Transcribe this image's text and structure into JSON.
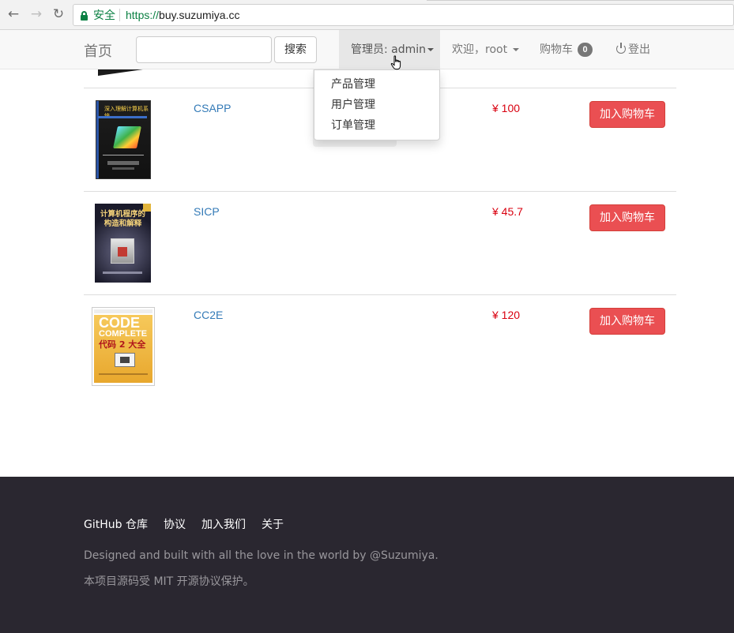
{
  "browser": {
    "back_icon": "←",
    "forward_icon": "→",
    "reload_icon": "↻",
    "secure_label": "安全",
    "url_scheme": "https://",
    "url_host": "buy.suzumiya.cc"
  },
  "navbar": {
    "brand": "首页",
    "search_placeholder": "",
    "search_button": "搜索",
    "admin_menu_label": "管理员: admin",
    "welcome_label": "欢迎，root",
    "cart_label": "购物车",
    "cart_count": "0",
    "logout_label": "登出"
  },
  "admin_dropdown": {
    "items": [
      "产品管理",
      "用户管理",
      "订单管理"
    ]
  },
  "products": [
    {
      "title": "CSAPP",
      "price": "¥ 100",
      "cover_text": "深入理解计算机系统",
      "button": "加入购物车"
    },
    {
      "title": "SICP",
      "price": "¥ 45.7",
      "cover_text_1": "计算机程序的",
      "cover_text_2": "构造和解释",
      "button": "加入购物车"
    },
    {
      "title": "CC2E",
      "price": "¥ 120",
      "cover_text_1": "CODE",
      "cover_text_2": "COMPLETE",
      "cover_text_3": "代码 2 大全",
      "button": "加入购物车"
    }
  ],
  "footer": {
    "links": [
      "GitHub 仓库",
      "协议",
      "加入我们",
      "关于"
    ],
    "line1": "Designed and built with all the love in the world by @Suzumiya.",
    "line2": "本项目源码受 MIT 开源协议保护。"
  },
  "colors": {
    "accent_button": "#ea4f52",
    "price": "#d9000f",
    "link": "#337ab7",
    "footer_bg": "#2a2730",
    "secure_green": "#0b8043"
  }
}
